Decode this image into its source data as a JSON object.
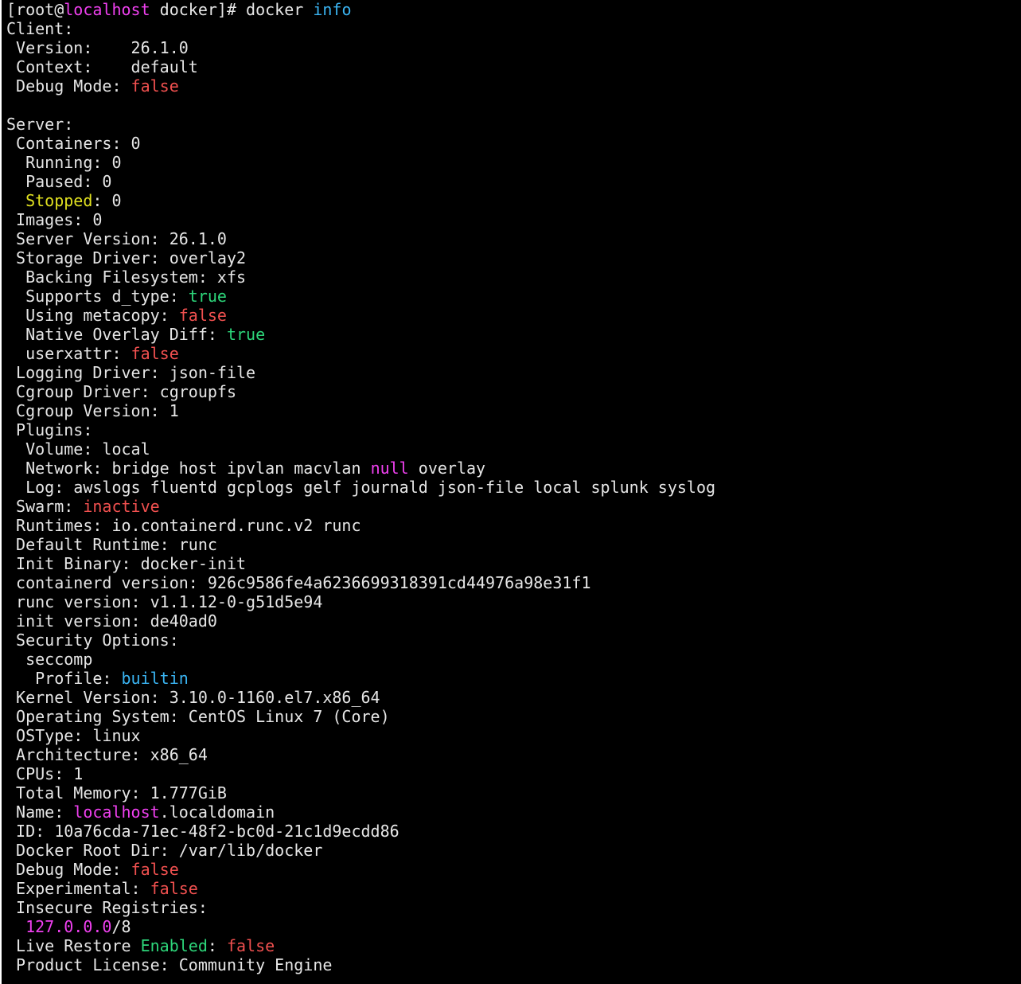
{
  "colors": {
    "background": "#000000",
    "default": "#e6e6e6",
    "magenta": "#f040f0",
    "cyan": "#3ab4f2",
    "red": "#f0504f",
    "green": "#2dd67a",
    "yellow": "#e0e020"
  },
  "lines": [
    [
      {
        "t": "[root@",
        "c": "default"
      },
      {
        "t": "localhost",
        "c": "magenta"
      },
      {
        "t": " docker]# docker ",
        "c": "default"
      },
      {
        "t": "info",
        "c": "cyan"
      }
    ],
    [
      {
        "t": "Client:",
        "c": "default"
      }
    ],
    [
      {
        "t": " Version:    26.1.0",
        "c": "default"
      }
    ],
    [
      {
        "t": " Context:    default",
        "c": "default"
      }
    ],
    [
      {
        "t": " Debug Mode: ",
        "c": "default"
      },
      {
        "t": "false",
        "c": "red"
      }
    ],
    [
      {
        "t": "",
        "c": "default"
      }
    ],
    [
      {
        "t": "Server:",
        "c": "default"
      }
    ],
    [
      {
        "t": " Containers: 0",
        "c": "default"
      }
    ],
    [
      {
        "t": "  Running: 0",
        "c": "default"
      }
    ],
    [
      {
        "t": "  Paused: 0",
        "c": "default"
      }
    ],
    [
      {
        "t": "  ",
        "c": "default"
      },
      {
        "t": "Stopped",
        "c": "yellow"
      },
      {
        "t": ": 0",
        "c": "default"
      }
    ],
    [
      {
        "t": " Images: 0",
        "c": "default"
      }
    ],
    [
      {
        "t": " Server Version: 26.1.0",
        "c": "default"
      }
    ],
    [
      {
        "t": " Storage Driver: overlay2",
        "c": "default"
      }
    ],
    [
      {
        "t": "  Backing Filesystem: xfs",
        "c": "default"
      }
    ],
    [
      {
        "t": "  Supports d_type: ",
        "c": "default"
      },
      {
        "t": "true",
        "c": "green"
      }
    ],
    [
      {
        "t": "  Using metacopy: ",
        "c": "default"
      },
      {
        "t": "false",
        "c": "red"
      }
    ],
    [
      {
        "t": "  Native Overlay Diff: ",
        "c": "default"
      },
      {
        "t": "true",
        "c": "green"
      }
    ],
    [
      {
        "t": "  userxattr: ",
        "c": "default"
      },
      {
        "t": "false",
        "c": "red"
      }
    ],
    [
      {
        "t": " Logging Driver: json-file",
        "c": "default"
      }
    ],
    [
      {
        "t": " Cgroup Driver: cgroupfs",
        "c": "default"
      }
    ],
    [
      {
        "t": " Cgroup Version: 1",
        "c": "default"
      }
    ],
    [
      {
        "t": " Plugins:",
        "c": "default"
      }
    ],
    [
      {
        "t": "  Volume: local",
        "c": "default"
      }
    ],
    [
      {
        "t": "  Network: bridge host ipvlan macvlan ",
        "c": "default"
      },
      {
        "t": "null",
        "c": "magenta"
      },
      {
        "t": " overlay",
        "c": "default"
      }
    ],
    [
      {
        "t": "  Log: awslogs fluentd gcplogs gelf journald json-file local splunk syslog",
        "c": "default"
      }
    ],
    [
      {
        "t": " Swarm: ",
        "c": "default"
      },
      {
        "t": "inactive",
        "c": "red"
      }
    ],
    [
      {
        "t": " Runtimes: io.containerd.runc.v2 runc",
        "c": "default"
      }
    ],
    [
      {
        "t": " Default Runtime: runc",
        "c": "default"
      }
    ],
    [
      {
        "t": " Init Binary: docker-init",
        "c": "default"
      }
    ],
    [
      {
        "t": " containerd version: 926c9586fe4a6236699318391cd44976a98e31f1",
        "c": "default"
      }
    ],
    [
      {
        "t": " runc version: v1.1.12-0-g51d5e94",
        "c": "default"
      }
    ],
    [
      {
        "t": " init version: de40ad0",
        "c": "default"
      }
    ],
    [
      {
        "t": " Security Options:",
        "c": "default"
      }
    ],
    [
      {
        "t": "  seccomp",
        "c": "default"
      }
    ],
    [
      {
        "t": "   Profile: ",
        "c": "default"
      },
      {
        "t": "builtin",
        "c": "cyan"
      }
    ],
    [
      {
        "t": " Kernel Version: 3.10.0-1160.el7.x86_64",
        "c": "default"
      }
    ],
    [
      {
        "t": " Operating System: CentOS Linux 7 (Core)",
        "c": "default"
      }
    ],
    [
      {
        "t": " OSType: linux",
        "c": "default"
      }
    ],
    [
      {
        "t": " Architecture: x86_64",
        "c": "default"
      }
    ],
    [
      {
        "t": " CPUs: 1",
        "c": "default"
      }
    ],
    [
      {
        "t": " Total Memory: 1.777GiB",
        "c": "default"
      }
    ],
    [
      {
        "t": " Name: ",
        "c": "default"
      },
      {
        "t": "localhost",
        "c": "magenta"
      },
      {
        "t": ".localdomain",
        "c": "default"
      }
    ],
    [
      {
        "t": " ID: 10a76cda-71ec-48f2-bc0d-21c1d9ecdd86",
        "c": "default"
      }
    ],
    [
      {
        "t": " Docker Root Dir: /var/lib/docker",
        "c": "default"
      }
    ],
    [
      {
        "t": " Debug Mode: ",
        "c": "default"
      },
      {
        "t": "false",
        "c": "red"
      }
    ],
    [
      {
        "t": " Experimental: ",
        "c": "default"
      },
      {
        "t": "false",
        "c": "red"
      }
    ],
    [
      {
        "t": " Insecure Registries:",
        "c": "default"
      }
    ],
    [
      {
        "t": "  ",
        "c": "default"
      },
      {
        "t": "127.0.0.0",
        "c": "magenta"
      },
      {
        "t": "/8",
        "c": "default"
      }
    ],
    [
      {
        "t": " Live Restore ",
        "c": "default"
      },
      {
        "t": "Enabled",
        "c": "green"
      },
      {
        "t": ": ",
        "c": "default"
      },
      {
        "t": "false",
        "c": "red"
      }
    ],
    [
      {
        "t": " Product License: Community Engine",
        "c": "default"
      }
    ]
  ]
}
